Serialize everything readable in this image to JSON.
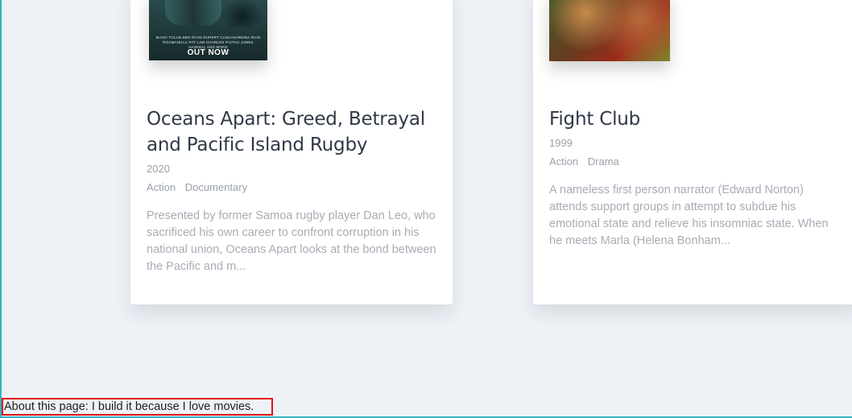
{
  "movies": [
    {
      "title": "Oceans Apart: Greed, Betrayal and Pacific Island Rugby",
      "year": "2020",
      "genres": [
        "Action",
        "Documentary"
      ],
      "description": "Presented by former Samoa rugby player Dan Leo, who sacrificed his own career to confront corruption in his national union, Oceans Apart looks at the bond between the Pacific and m...",
      "poster": {
        "credits": "MAHO TOLAB  DEN RYAN  RUPERT CASCAVARDINA  RIAN ROAMANILLA  PAT LAM  CHARLES PIUTAU  JAMES HASKELL AND MORE",
        "cta": "OUT NOW"
      }
    },
    {
      "title": "Fight Club",
      "year": "1999",
      "genres": [
        "Action",
        "Drama"
      ],
      "description": "A nameless first person narrator (Edward Norton) attends support groups in attempt to subdue his emotional state and relieve his insomniac state. When he meets Marla (Helena Bonham..."
    }
  ],
  "footer": {
    "text": "About this page: I build it because I love movies."
  }
}
